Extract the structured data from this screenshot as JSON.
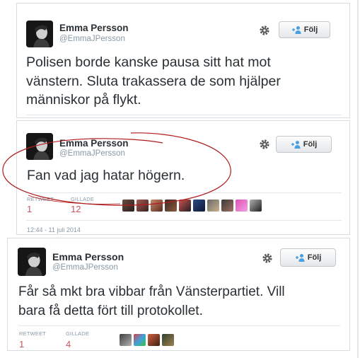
{
  "tweets": [
    {
      "name": "Emma Persson",
      "handle": "@EmmaJPersson",
      "follow_label": "Följ",
      "text_lines": [
        "Polisen borde kanske pausa sitt hat mot",
        "vänstern. Sluta trakassera de som hjälper",
        "människor på flykt."
      ]
    },
    {
      "name": "Emma Persson",
      "handle": "@EmmaJPersson",
      "follow_label": "Följ",
      "text_lines": [
        "Fan vad jag hatar högern."
      ],
      "retweet_label": "RETWEET",
      "retweet_count": "1",
      "favorite_label": "GILLADE",
      "favorite_count": "12",
      "timestamp": "12:44 - 11 juli 2014",
      "avatar_count": 10
    },
    {
      "name": "Emma Persson",
      "handle": "@EmmaJPersson",
      "follow_label": "Följ",
      "text_lines": [
        "Får så mkt bra vibbar från Vänsterpartiet. Vill",
        "bara få detta fört till protokollet."
      ],
      "retweet_label": "RETWEET",
      "retweet_count": "1",
      "favorite_label": "GILLADE",
      "favorite_count": "4",
      "avatar_count": 4
    }
  ],
  "colors": {
    "stat_value": "#c8555e",
    "scribble": "#b01c1c",
    "follow_icon": "#4a9fe0",
    "card_border": "#d9dde0"
  },
  "icons": [
    "gear-icon",
    "follow-person-icon"
  ]
}
